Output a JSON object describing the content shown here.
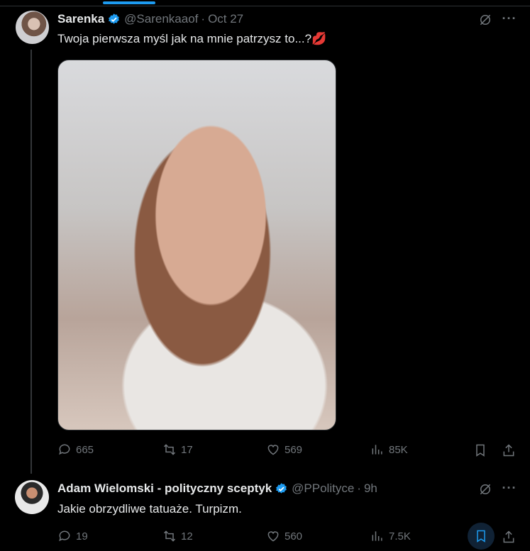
{
  "tweets": [
    {
      "display_name": "Sarenka",
      "handle": "@Sarenkaaof",
      "separator": "·",
      "time": "Oct 27",
      "text": "Twoja pierwsza myśl jak na mnie patrzysz to...?💋",
      "metrics": {
        "replies": "665",
        "reposts": "17",
        "likes": "569",
        "views": "85K"
      }
    },
    {
      "display_name": "Adam Wielomski - polityczny sceptyk",
      "handle": "@PPolityce",
      "separator": "·",
      "time": "9h",
      "text": "Jakie obrzydliwe tatuaże. Turpizm.",
      "metrics": {
        "replies": "19",
        "reposts": "12",
        "likes": "560",
        "views": "7.5K"
      }
    }
  ],
  "more_label": "···",
  "colors": {
    "background": "#000000",
    "text": "#e7e9ea",
    "muted": "#71767b",
    "accent": "#1d9bf0",
    "border": "#2f3336"
  },
  "icons": [
    "verified-badge-icon",
    "grok-icon",
    "more-icon",
    "reply-icon",
    "repost-icon",
    "like-icon",
    "views-icon",
    "bookmark-icon",
    "share-icon"
  ]
}
